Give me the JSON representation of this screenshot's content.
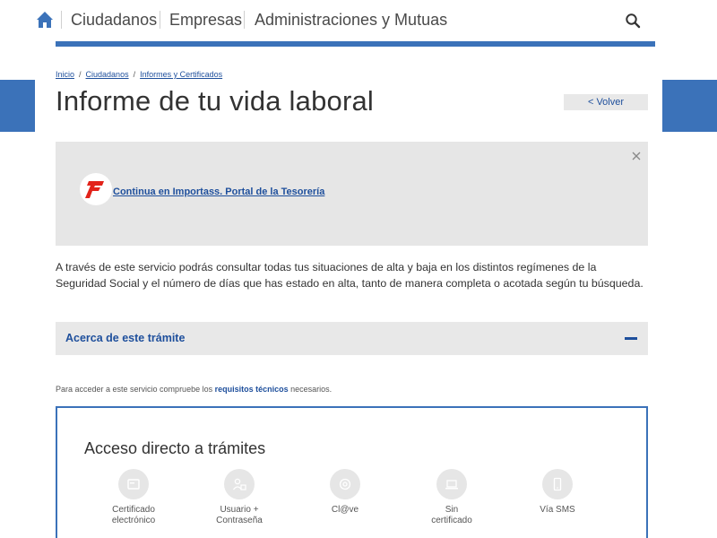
{
  "nav": {
    "items": [
      "Ciudadanos",
      "Empresas",
      "Administraciones y Mutuas"
    ]
  },
  "breadcrumb": {
    "items": [
      "Inicio",
      "Ciudadanos",
      "Informes y Certificados"
    ],
    "separator": "/"
  },
  "page": {
    "title": "Informe de tu vida laboral",
    "back_label": "< Volver"
  },
  "notice": {
    "link_text": "Continua en Importass. Portal de la Tesorería"
  },
  "description": "A través de este servicio podrás consultar todas tus situaciones de alta y baja en los distintos regímenes de la Seguridad Social y el número de días que has estado en alta, tanto de manera completa o acotada según tu búsqueda.",
  "accordion": {
    "title": "Acerca de este trámite"
  },
  "requirements": {
    "prefix": "Para acceder a este servicio compruebe los ",
    "link": "requisitos técnicos",
    "suffix": " necesarios."
  },
  "access": {
    "title": "Acceso directo a trámites",
    "options": [
      {
        "label": "Certificado\nelectrónico",
        "icon": "certificate-icon"
      },
      {
        "label": "Usuario +\nContraseña",
        "icon": "user-password-icon"
      },
      {
        "label": "Cl@ve",
        "icon": "at-icon"
      },
      {
        "label": "Sin\ncertificado",
        "icon": "laptop-icon"
      },
      {
        "label": "Vía SMS",
        "icon": "mobile-icon"
      }
    ]
  },
  "colors": {
    "brand_blue": "#3b72b9",
    "link_blue": "#1e4f9c",
    "panel_gray": "#e6e6e6",
    "logo_red": "#e2231a"
  }
}
